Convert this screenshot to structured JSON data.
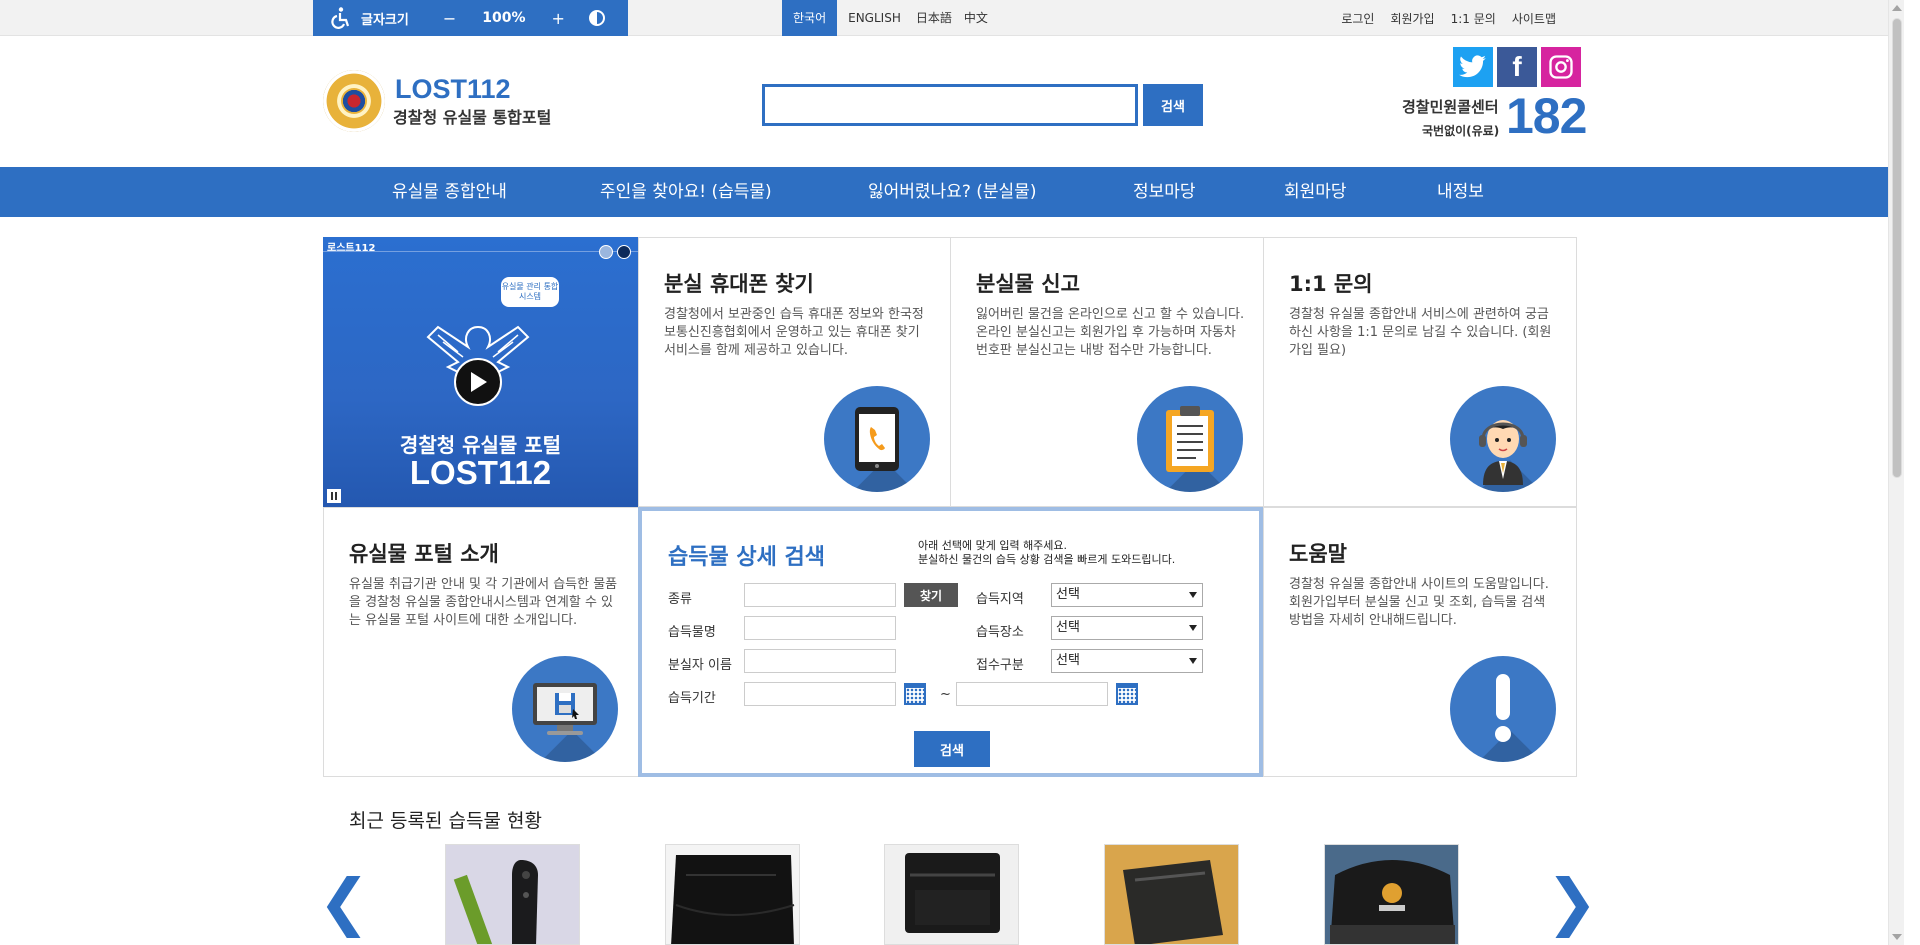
{
  "accessibility": {
    "font_size_label": "글자크기",
    "minus": "−",
    "zoom": "100%",
    "plus": "+"
  },
  "languages": [
    {
      "label": "한국어",
      "active": true
    },
    {
      "label": "ENGLISH",
      "active": false
    },
    {
      "label": "日本語",
      "active": false
    },
    {
      "label": "中文",
      "active": false
    }
  ],
  "utility_links": [
    "로그인",
    "회원가입",
    "1:1 문의",
    "사이트맵"
  ],
  "header": {
    "logo_title": "LOST112",
    "logo_subtitle": "경찰청 유실물 통합포털",
    "search_button": "검색",
    "search_value": "",
    "call_center_label": "경찰민원콜센터",
    "call_center_note": "국번없이(유료)",
    "call_number": "182"
  },
  "nav": [
    "유실물 종합안내",
    "주인을 찾아요! (습득물)",
    "잃어버렸나요? (분실물)",
    "정보마당",
    "회원마당",
    "내정보"
  ],
  "video": {
    "label": "로스트112",
    "bubble": "유실물 관리 통합 시스템",
    "title_line1": "경찰청 유실물 포털",
    "title_line2": "LOST112"
  },
  "cards": {
    "phone": {
      "title": "분실 휴대폰 찾기",
      "text": "경찰청에서 보관중인 습득 휴대폰 정보와 한국정보통신진흥협회에서 운영하고 있는 휴대폰 찾기 서비스를 함께 제공하고 있습니다."
    },
    "report": {
      "title": "분실물 신고",
      "text": "잃어버린 물건을 온라인으로 신고 할 수 있습니다. 온라인 분실신고는 회원가입 후 가능하며 자동차 번호판 분실신고는 내방 접수만 가능합니다."
    },
    "inquiry": {
      "title": "1:1 문의",
      "text": "경찰청 유실물 종합안내 서비스에 관련하여 궁금하신 사항을 1:1 문의로 남길 수 있습니다. (회원가입 필요)"
    },
    "intro": {
      "title": "유실물 포털 소개",
      "text": "유실물 취급기관 안내 및 각 기관에서 습득한 물품을 경찰청 유실물 종합안내시스템과 연계할 수 있는 유실물 포털 사이트에 대한 소개입니다."
    },
    "help": {
      "title": "도움말",
      "text": "경찰청 유실물 종합안내 사이트의 도움말입니다. 회원가입부터 분실물 신고 및 조회, 습득물 검색 방법을 자세히 안내해드립니다."
    }
  },
  "detail_search": {
    "title": "습득물 상세 검색",
    "note_line1": "아래 선택에 맞게 입력 해주세요.",
    "note_line2": "분실하신 물건의 습득 상황 검색을 빠르게 도와드립니다.",
    "labels": {
      "type": "종류",
      "item_name": "습득물명",
      "owner_name": "분실자 이름",
      "period": "습득기간",
      "region": "습득지역",
      "place": "습득장소",
      "category": "접수구분"
    },
    "find_button": "찾기",
    "select_default": "선택",
    "tilde": "~",
    "search_button": "검색"
  },
  "recent": {
    "title": "최근 등록된 습득물 현황",
    "prev": "❮",
    "next": "❯"
  },
  "colors": {
    "brand_blue": "#2e6fc2",
    "nav_blue": "#2e6fc2",
    "detail_border": "#9fbde4"
  }
}
